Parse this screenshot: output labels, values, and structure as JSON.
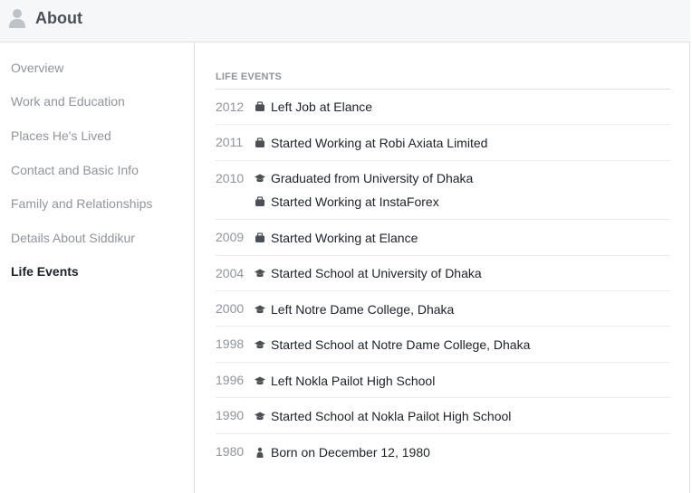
{
  "header": {
    "title": "About",
    "icon": "person-icon"
  },
  "sidebar": {
    "items": [
      {
        "label": "Overview",
        "active": false
      },
      {
        "label": "Work and Education",
        "active": false
      },
      {
        "label": "Places He's Lived",
        "active": false
      },
      {
        "label": "Contact and Basic Info",
        "active": false
      },
      {
        "label": "Family and Relationships",
        "active": false
      },
      {
        "label": "Details About Siddikur",
        "active": false
      },
      {
        "label": "Life Events",
        "active": true
      }
    ]
  },
  "life_events": {
    "section_title": "LIFE EVENTS",
    "years": [
      {
        "year": "2012",
        "events": [
          {
            "icon": "briefcase-icon",
            "text": "Left Job at Elance"
          }
        ]
      },
      {
        "year": "2011",
        "events": [
          {
            "icon": "briefcase-icon",
            "text": "Started Working at Robi Axiata Limited"
          }
        ]
      },
      {
        "year": "2010",
        "events": [
          {
            "icon": "graduation-cap-icon",
            "text": "Graduated from University of Dhaka"
          },
          {
            "icon": "briefcase-icon",
            "text": "Started Working at InstaForex"
          }
        ]
      },
      {
        "year": "2009",
        "events": [
          {
            "icon": "briefcase-icon",
            "text": "Started Working at Elance"
          }
        ]
      },
      {
        "year": "2004",
        "events": [
          {
            "icon": "graduation-cap-icon",
            "text": "Started School at University of Dhaka"
          }
        ]
      },
      {
        "year": "2000",
        "events": [
          {
            "icon": "graduation-cap-icon",
            "text": "Left Notre Dame College, Dhaka"
          }
        ]
      },
      {
        "year": "1998",
        "events": [
          {
            "icon": "graduation-cap-icon",
            "text": "Started School at Notre Dame College, Dhaka"
          }
        ]
      },
      {
        "year": "1996",
        "events": [
          {
            "icon": "graduation-cap-icon",
            "text": "Left Nokla Pailot High School"
          }
        ]
      },
      {
        "year": "1990",
        "events": [
          {
            "icon": "graduation-cap-icon",
            "text": "Started School at Nokla Pailot High School"
          }
        ]
      },
      {
        "year": "1980",
        "events": [
          {
            "icon": "baby-icon",
            "text": "Born on December 12, 1980"
          }
        ]
      }
    ]
  }
}
